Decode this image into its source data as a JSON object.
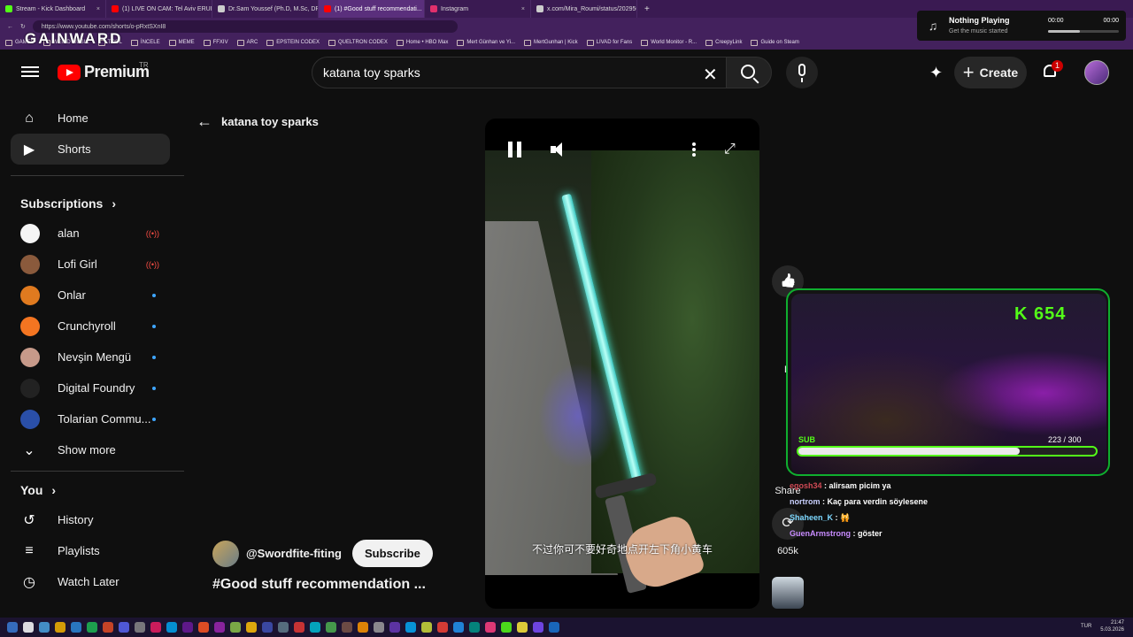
{
  "browser": {
    "tabs": [
      {
        "label": "Stream - Kick Dashboard",
        "color": "#53fc18"
      },
      {
        "label": "(1) LIVE ON CAM: Tel Aviv ERUPTS",
        "color": "#ff0000"
      },
      {
        "label": "Dr.Sam Youssef (Ph.D, M.Sc, DPT...",
        "color": "#cccccc"
      },
      {
        "label": "(1) #Good stuff recommendati...",
        "color": "#ff0000",
        "active": true
      },
      {
        "label": "Instagram",
        "color": "#e1306c"
      },
      {
        "label": "x.com/Mira_Roumi/status/202956...",
        "color": "#cccccc"
      }
    ],
    "url": "https://www.youtube.com/shorts/o-pRxtSXnI8",
    "bookmarks": [
      "GAMES",
      "WEIRD MUSIC",
      "TOOL",
      "İNCELE",
      "MEME",
      "FFXIV",
      "ARC",
      "EPSTEIN CODEX",
      "QUELTRON CODEX",
      "Home • HBO Max",
      "Mert Günhan ve Yi...",
      "MertGunhan | Kick",
      "LIVAD for Fans",
      "World Monitor - R...",
      "CreepyLink",
      "Guide on Steam"
    ],
    "overlay_logo": "GAINWARD"
  },
  "now_playing": {
    "title": "Nothing Playing",
    "subtitle": "Get the music started",
    "time_left": "00:00",
    "time_right": "00:00",
    "progress": 0.45
  },
  "header": {
    "logo_word": "Premium",
    "logo_region": "TR",
    "search_value": "katana toy sparks",
    "create_label": "Create",
    "notification_count": "1"
  },
  "sidebar": {
    "main": [
      {
        "label": "Home",
        "icon": "home-icon"
      },
      {
        "label": "Shorts",
        "icon": "shorts-icon",
        "active": true
      }
    ],
    "subscriptions_title": "Subscriptions",
    "subscriptions": [
      {
        "name": "alan",
        "status": "live",
        "avatar_color": "#f5f5f5"
      },
      {
        "name": "Lofi Girl",
        "status": "live",
        "avatar_color": "#8a5a3c"
      },
      {
        "name": "Onlar",
        "status": "new",
        "avatar_color": "#e07a1f"
      },
      {
        "name": "Crunchyroll",
        "status": "new",
        "avatar_color": "#f47521"
      },
      {
        "name": "Nevşin Mengü",
        "status": "new",
        "avatar_color": "#c79a8a"
      },
      {
        "name": "Digital Foundry",
        "status": "new",
        "avatar_color": "#222222"
      },
      {
        "name": "Tolarian Commu...",
        "status": "new",
        "avatar_color": "#2a4fa8"
      }
    ],
    "show_more": "Show more",
    "you_title": "You",
    "you_items": [
      {
        "label": "History",
        "icon": "history-icon"
      },
      {
        "label": "Playlists",
        "icon": "playlists-icon"
      },
      {
        "label": "Watch Later",
        "icon": "watch-later-icon"
      }
    ]
  },
  "main": {
    "back_label": "katana toy sparks",
    "video_subtitle": "不过你可不要好奇地点开左下角小黄车",
    "channel": "@Swordfite-fiting",
    "subscribe_label": "Subscribe",
    "video_title": "#Good stuff recommendation ...",
    "actions": {
      "share_label": "Share",
      "remix_count": "605k",
      "d_label": "D"
    }
  },
  "stream_overlay": {
    "kick_count": "654",
    "kick_prefix": "K",
    "sub_label": "SUB",
    "sub_current": 223,
    "sub_goal": 300,
    "sub_count_text": "223 / 300",
    "chat": [
      {
        "user": "egosh34",
        "msg": "alirsam picim ya"
      },
      {
        "user": "nortrom",
        "msg": "Kaç para verdin söylesene"
      },
      {
        "user": "Shaheen_K",
        "msg": "🙀"
      },
      {
        "user": "GuenArmstrong",
        "msg": "göster"
      }
    ]
  },
  "taskbar": {
    "lang": "TUR",
    "time": "21:47",
    "date": "5.03.2026"
  }
}
